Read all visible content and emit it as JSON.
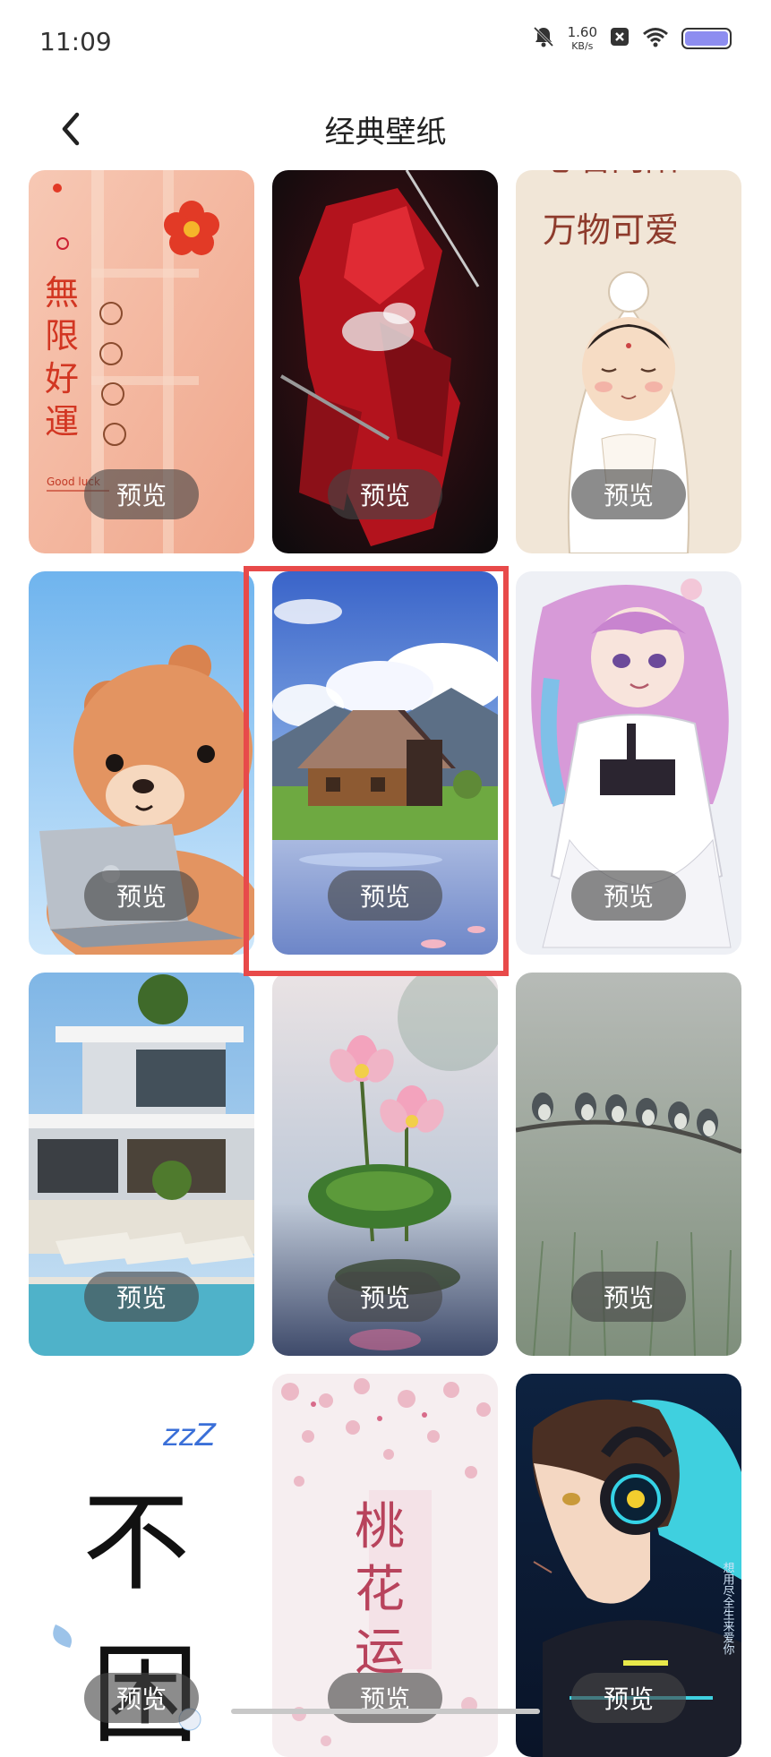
{
  "status_bar": {
    "time": "11:09",
    "speed_value": "1.60",
    "speed_unit": "KB/s",
    "icons": [
      "mute-bell-icon",
      "notification-x-icon",
      "wifi-icon",
      "battery-icon"
    ]
  },
  "header": {
    "title": "经典壁纸",
    "back_icon": "chevron-left-icon"
  },
  "wallpapers": [
    {
      "theme": "lucky-flower",
      "label": "预览",
      "art_text": [
        "無",
        "限",
        "好",
        "運"
      ],
      "art_small_text": "Good luck"
    },
    {
      "theme": "red-mecha",
      "label": "预览"
    },
    {
      "theme": "buddha",
      "label": "预览",
      "art_text": [
        "心若向阳",
        "万物可爱"
      ]
    },
    {
      "theme": "bear-laptop",
      "label": "预览"
    },
    {
      "theme": "lake-house",
      "label": "预览",
      "selected": true
    },
    {
      "theme": "anime-girl-lolita",
      "label": "预览"
    },
    {
      "theme": "modern-villa-pool",
      "label": "预览"
    },
    {
      "theme": "lotus",
      "label": "预览"
    },
    {
      "theme": "birds-on-branch",
      "label": "预览"
    },
    {
      "theme": "sleepy-text",
      "label": "预览",
      "art_text": [
        "不",
        "困"
      ],
      "art_small_text": "zzZ"
    },
    {
      "theme": "peach-blossom",
      "label": "预览",
      "art_text": [
        "桃",
        "花",
        "运"
      ]
    },
    {
      "theme": "headphone-boy",
      "label": "预览",
      "art_side_text": "想用尽全生来爱你"
    }
  ],
  "colors": {
    "selection_outline": "#e84a4a",
    "preview_pill": "rgba(70,70,70,0.62)"
  }
}
